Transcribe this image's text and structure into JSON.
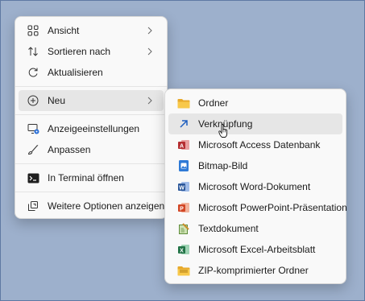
{
  "context_menu": {
    "items": [
      {
        "label": "Ansicht",
        "icon": "grid-icon",
        "submenu": true
      },
      {
        "label": "Sortieren nach",
        "icon": "sort-arrows-icon",
        "submenu": true
      },
      {
        "label": "Aktualisieren",
        "icon": "refresh-icon",
        "submenu": false
      },
      {
        "label": "Neu",
        "icon": "plus-circle-icon",
        "submenu": true
      },
      {
        "label": "Anzeigeeinstellungen",
        "icon": "display-settings-icon",
        "submenu": false
      },
      {
        "label": "Anpassen",
        "icon": "brush-icon",
        "submenu": false
      },
      {
        "label": "In Terminal öffnen",
        "icon": "terminal-icon",
        "submenu": false
      },
      {
        "label": "Weitere Optionen anzeigen",
        "icon": "more-options-icon",
        "submenu": false
      }
    ]
  },
  "new_submenu": {
    "hovered_index": 1,
    "items": [
      {
        "label": "Ordner",
        "icon": "folder-icon"
      },
      {
        "label": "Verknüpfung",
        "icon": "shortcut-icon"
      },
      {
        "label": "Microsoft Access Datenbank",
        "icon": "access-icon"
      },
      {
        "label": "Bitmap-Bild",
        "icon": "bitmap-icon"
      },
      {
        "label": "Microsoft Word-Dokument",
        "icon": "word-icon"
      },
      {
        "label": "Microsoft PowerPoint-Präsentation",
        "icon": "powerpoint-icon"
      },
      {
        "label": "Textdokument",
        "icon": "text-document-icon"
      },
      {
        "label": "Microsoft Excel-Arbeitsblatt",
        "icon": "excel-icon"
      },
      {
        "label": "ZIP-komprimierter Ordner",
        "icon": "zip-folder-icon"
      }
    ]
  },
  "colors": {
    "desktop": "#9db0cc",
    "menu_background": "#f9f9f9",
    "hover": "#e6e6e6",
    "access": "#c0392b",
    "word": "#2b579a",
    "powerpoint": "#d24726",
    "excel": "#217346",
    "folder": "#f4c542"
  }
}
